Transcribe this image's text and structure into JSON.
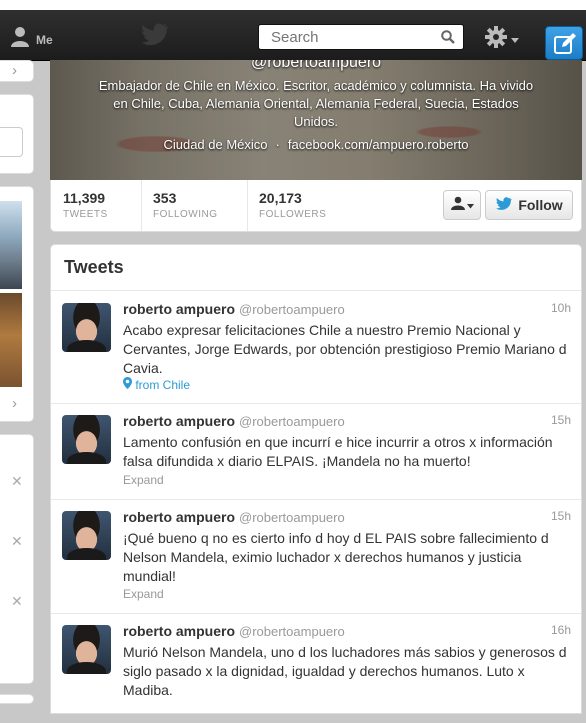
{
  "nav": {
    "me_label": "Me",
    "search_placeholder": "Search",
    "icons": [
      "person-icon",
      "twitter-bird-icon",
      "search-icon",
      "gear-icon",
      "compose-icon"
    ]
  },
  "profile": {
    "handle": "@robertoampuero",
    "bio": "Embajador de Chile en México. Escritor, académico y columnista. Ha vivido en Chile, Cuba, Alemania Oriental, Alemania Federal, Suecia, Estados Unidos.",
    "location": "Ciudad de México",
    "separator": "·",
    "website": "facebook.com/ampuero.roberto"
  },
  "stats": {
    "tweets": {
      "value": "11,399",
      "label": "TWEETS"
    },
    "following": {
      "value": "353",
      "label": "FOLLOWING"
    },
    "followers": {
      "value": "20,173",
      "label": "FOLLOWERS"
    }
  },
  "actions": {
    "follow_label": "Follow"
  },
  "timeline": {
    "title": "Tweets",
    "tweets": [
      {
        "name": "roberto ampuero",
        "handle": "@robertoampuero",
        "time": "10h",
        "text": "Acabo expresar felicitaciones Chile a nuestro Premio Nacional y Cervantes, Jorge Edwards, por obtención prestigioso Premio Mariano d Cavia.",
        "meta": "from Chile"
      },
      {
        "name": "roberto ampuero",
        "handle": "@robertoampuero",
        "time": "15h",
        "text": "Lamento confusión en que incurrí e hice incurrir a otros x información falsa difundida x diario ELPAIS. ¡Mandela no ha muerto!",
        "meta": "Expand"
      },
      {
        "name": "roberto ampuero",
        "handle": "@robertoampuero",
        "time": "15h",
        "text": "¡Qué bueno q no es cierto info d hoy d EL PAIS sobre fallecimiento d Nelson Mandela, eximio luchador x derechos humanos y justicia mundial!",
        "meta": "Expand"
      },
      {
        "name": "roberto ampuero",
        "handle": "@robertoampuero",
        "time": "16h",
        "text": "Murió Nelson Mandela, uno d los luchadores más sabios y generosos d siglo pasado x la dignidad, igualdad y derechos humanos. Luto x Madiba.",
        "meta": ""
      }
    ]
  },
  "colors": {
    "accent": "#2b9bd8",
    "nav_bg": "#222222",
    "compose": "#2a8fd8"
  }
}
